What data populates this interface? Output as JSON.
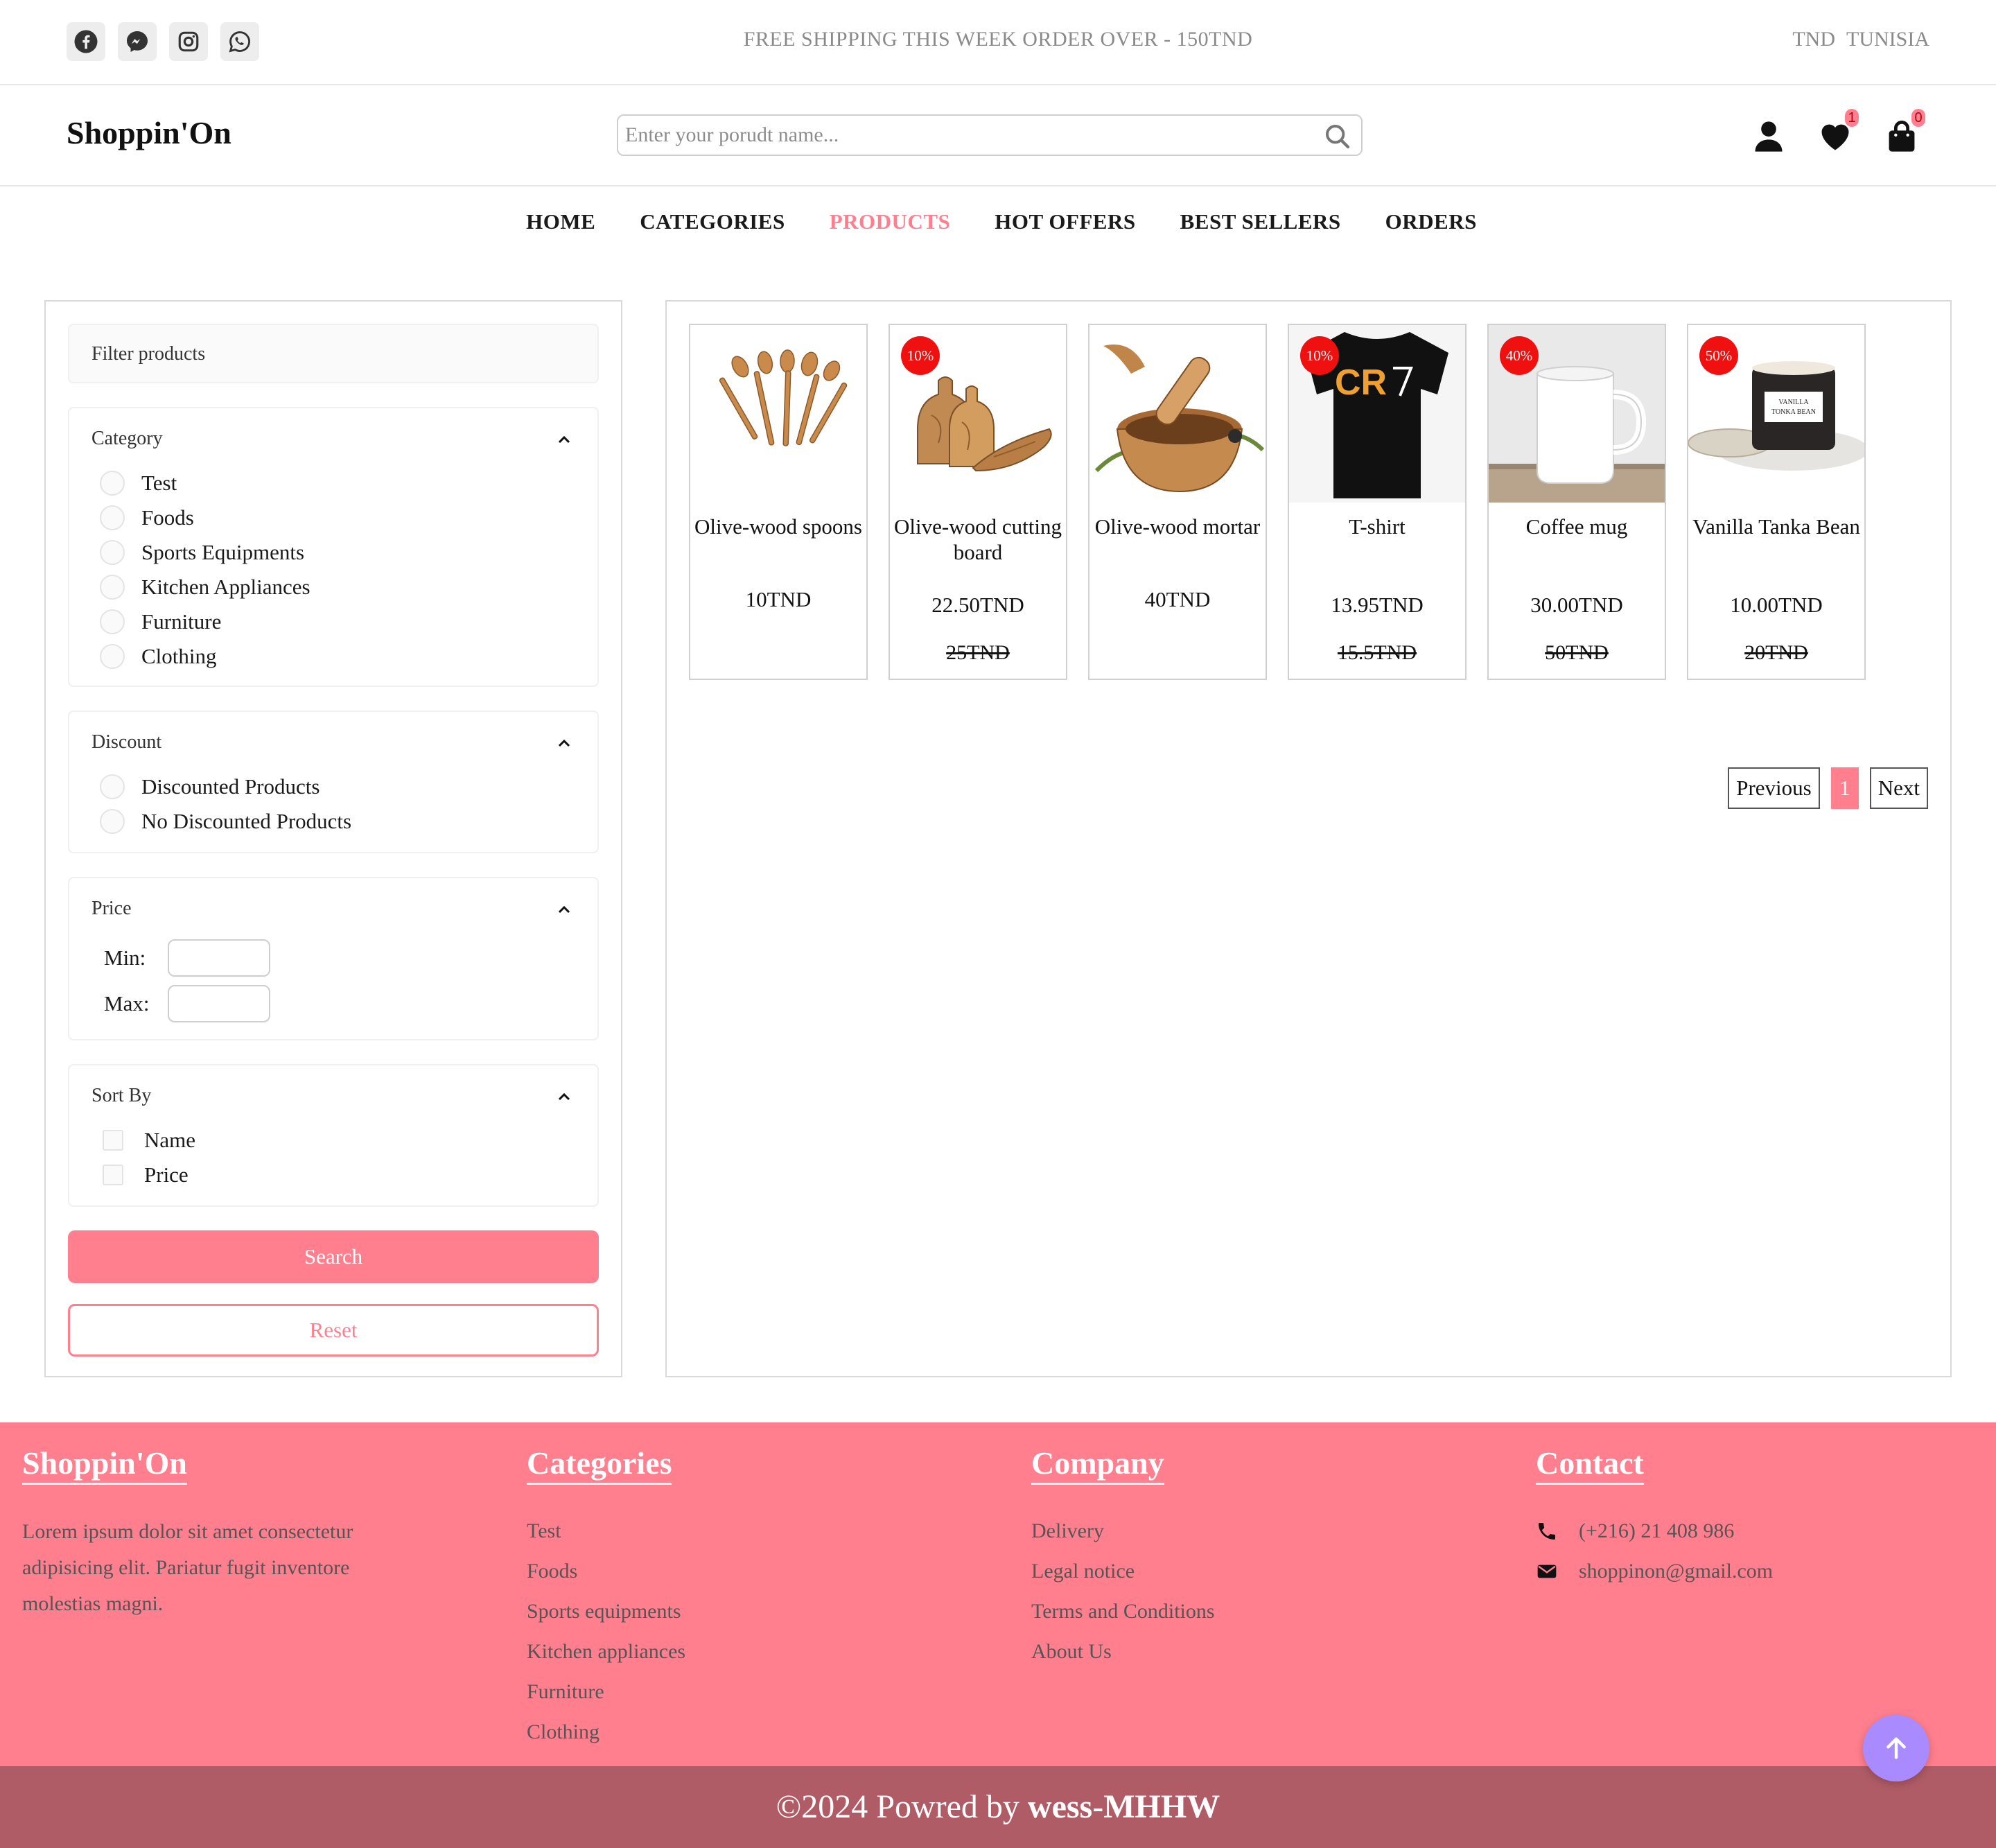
{
  "topbar": {
    "social": [
      "facebook-icon",
      "messenger-icon",
      "instagram-icon",
      "whatsapp-icon"
    ],
    "promo": "FREE SHIPPING THIS WEEK ORDER OVER - 150TND",
    "currency": "TND",
    "country": "TUNISIA"
  },
  "header": {
    "logo": "Shoppin'On",
    "search_placeholder": "Enter your porudt name...",
    "wishlist_count": "1",
    "cart_count": "0"
  },
  "nav": [
    {
      "label": "HOME",
      "active": false
    },
    {
      "label": "CATEGORIES",
      "active": false
    },
    {
      "label": "PRODUCTS",
      "active": true
    },
    {
      "label": "HOT OFFERS",
      "active": false
    },
    {
      "label": "BEST SELLERS",
      "active": false
    },
    {
      "label": "ORDERS",
      "active": false
    }
  ],
  "filters": {
    "title": "Filter products",
    "category": {
      "title": "Category",
      "options": [
        "Test",
        "Foods",
        "Sports Equipments",
        "Kitchen Appliances",
        "Furniture",
        "Clothing"
      ]
    },
    "discount": {
      "title": "Discount",
      "options": [
        "Discounted Products",
        "No Discounted Products"
      ]
    },
    "price": {
      "title": "Price",
      "min_label": "Min:",
      "max_label": "Max:",
      "min_value": "",
      "max_value": ""
    },
    "sort": {
      "title": "Sort By",
      "options": [
        "Name",
        "Price"
      ]
    },
    "search_label": "Search",
    "reset_label": "Reset"
  },
  "products": [
    {
      "name": "Olive-wood spoons",
      "price": "10TND",
      "old_price": "",
      "discount": ""
    },
    {
      "name": "Olive-wood cutting board",
      "price": "22.50TND",
      "old_price": "25TND",
      "discount": "10%"
    },
    {
      "name": "Olive-wood mortar",
      "price": "40TND",
      "old_price": "",
      "discount": ""
    },
    {
      "name": "T-shirt",
      "price": "13.95TND",
      "old_price": "15.5TND",
      "discount": "10%"
    },
    {
      "name": "Coffee mug",
      "price": "30.00TND",
      "old_price": "50TND",
      "discount": "40%"
    },
    {
      "name": "Vanilla Tanka Bean",
      "price": "10.00TND",
      "old_price": "20TND",
      "discount": "50%"
    }
  ],
  "pagination": {
    "previous": "Previous",
    "current": "1",
    "next": "Next"
  },
  "footer": {
    "brand": {
      "title": "Shoppin'On",
      "text": "Lorem ipsum dolor sit amet consectetur adipisicing elit. Pariatur fugit inventore molestias magni."
    },
    "categories": {
      "title": "Categories",
      "items": [
        "Test",
        "Foods",
        "Sports equipments",
        "Kitchen appliances",
        "Furniture",
        "Clothing"
      ]
    },
    "company": {
      "title": "Company",
      "items": [
        "Delivery",
        "Legal notice",
        "Terms and Conditions",
        "About Us"
      ]
    },
    "contact": {
      "title": "Contact",
      "phone": "(+216) 21 408 986",
      "email": "shoppinon@gmail.com"
    },
    "copyright_prefix": "©2024 Powred by",
    "copyright_author": "wess-MHHW"
  },
  "colors": {
    "accent": "#ff7f8e",
    "footer_bottom": "#b05c66",
    "discount_badge": "#f01010",
    "scroll_top": "#a98bff"
  }
}
